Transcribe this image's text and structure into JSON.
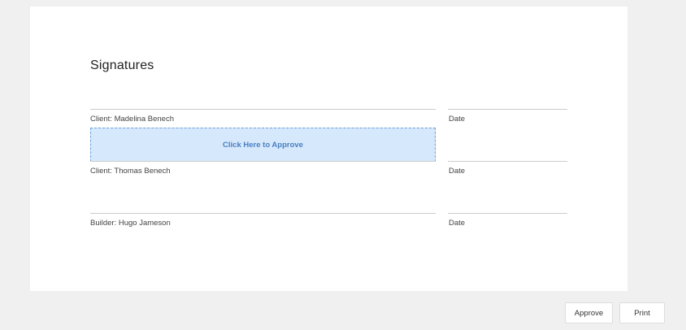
{
  "signatures": {
    "heading": "Signatures",
    "approve_prompt": "Click Here to Approve",
    "rows": [
      {
        "label": "Client: Madelina Benech",
        "date_label": "Date"
      },
      {
        "label": "Client: Thomas Benech",
        "date_label": "Date"
      },
      {
        "label": "Builder: Hugo Jameson",
        "date_label": "Date"
      }
    ]
  },
  "actions": {
    "approve_label": "Approve",
    "print_label": "Print"
  },
  "colors": {
    "page_background": "#f0f0f0",
    "approve_box_fill": "#d6e8fb",
    "approve_box_border": "#6fa0d8",
    "approve_text": "#4a7fc3"
  }
}
